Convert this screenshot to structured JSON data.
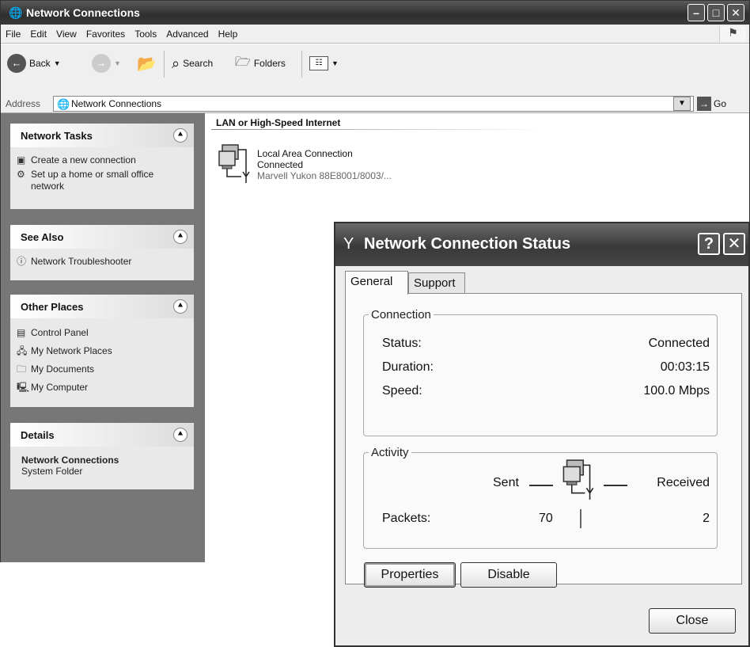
{
  "window": {
    "title": "Network Connections",
    "controls": [
      "minimize-icon",
      "maximize-icon",
      "close-icon"
    ]
  },
  "menu": [
    "File",
    "Edit",
    "View",
    "Favorites",
    "Tools",
    "Advanced",
    "Help"
  ],
  "toolbar": {
    "back": "Back",
    "search": "Search",
    "folders": "Folders"
  },
  "address": {
    "label": "Address",
    "value": "Network Connections",
    "go": "Go"
  },
  "taskpane": {
    "network_tasks": {
      "title": "Network Tasks",
      "items": [
        "Create a new connection",
        "Set up a home or small office network"
      ]
    },
    "see_also": {
      "title": "See Also",
      "items": [
        "Network Troubleshooter"
      ]
    },
    "other_places": {
      "title": "Other Places",
      "items": [
        "Control Panel",
        "My Network Places",
        "My Documents",
        "My Computer"
      ]
    },
    "details": {
      "title": "Details",
      "name": "Network Connections",
      "type": "System Folder"
    }
  },
  "content": {
    "group": "LAN or High-Speed Internet",
    "connection": {
      "name": "Local Area Connection",
      "status": "Connected",
      "device": "Marvell Yukon 88E8001/8003/..."
    }
  },
  "dialog": {
    "title": "Network Connection Status",
    "help": "?",
    "tabs": [
      "General",
      "Support"
    ],
    "connection": {
      "legend": "Connection",
      "status_label": "Status:",
      "status_value": "Connected",
      "duration_label": "Duration:",
      "duration_value": "00:03:15",
      "speed_label": "Speed:",
      "speed_value": "100.0 Mbps"
    },
    "activity": {
      "legend": "Activity",
      "sent": "Sent",
      "received": "Received",
      "packets_label": "Packets:",
      "packets_sent": "70",
      "packets_received": "2"
    },
    "buttons": {
      "properties": "Properties",
      "disable": "Disable",
      "close": "Close"
    }
  }
}
